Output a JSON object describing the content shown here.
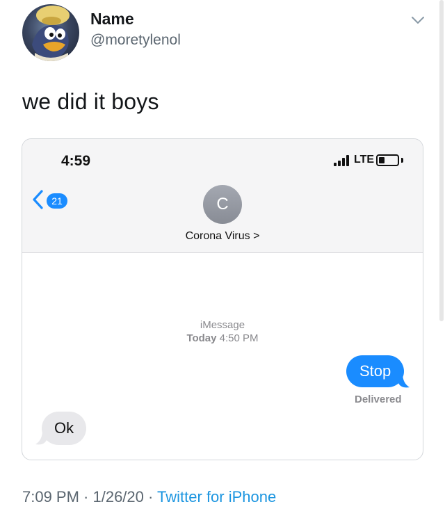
{
  "tweet": {
    "author_name": "Name",
    "author_handle": "@moretylenol",
    "text": "we did it boys",
    "timestamp": "7:09 PM · 1/26/20 · ",
    "source": "Twitter for iPhone",
    "menu_icon": "chevron-down-icon",
    "avatar_icon": "avatar"
  },
  "screenshot": {
    "status_time": "4:59",
    "network": "LTE",
    "back_badge": "21",
    "contact_initial": "C",
    "contact_name": "Corona Virus >",
    "service": "iMessage",
    "date_day": "Today",
    "date_time": "4:50 PM",
    "messages": [
      {
        "direction": "outgoing",
        "text": "Stop"
      },
      {
        "direction": "incoming",
        "text": "Ok"
      }
    ],
    "delivery_status": "Delivered"
  },
  "colors": {
    "imessage_blue": "#1a8cff",
    "incoming_gray": "#e8e8eb",
    "link_blue": "#1b95e0"
  }
}
